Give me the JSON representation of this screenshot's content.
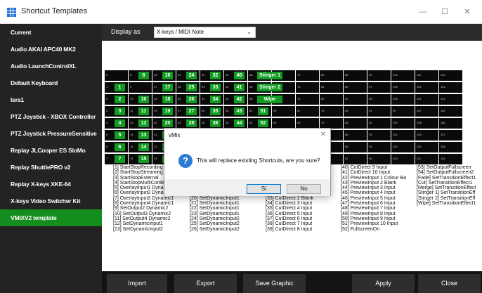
{
  "window": {
    "title": "Shortcut Templates",
    "minimize": "—",
    "maximize": "☐",
    "close": "✕"
  },
  "sidebar": {
    "items": [
      {
        "label": "Current",
        "active": false
      },
      {
        "label": "Audio AKAI APC40 MK2",
        "active": false
      },
      {
        "label": "Audio LaunchControlXL",
        "active": false
      },
      {
        "label": "Default Keyboard",
        "active": false
      },
      {
        "label": "Isra1",
        "active": false
      },
      {
        "label": "PTZ Joystick - XBOX Controller",
        "active": false
      },
      {
        "label": "PTZ Joystick PressureSensitive",
        "active": false
      },
      {
        "label": "Replay JLCooper ES SloMo",
        "active": false
      },
      {
        "label": "Replay ShuttlePRO v2",
        "active": false
      },
      {
        "label": "Replay X-keys XKE-64",
        "active": false
      },
      {
        "label": "X-keys Video Switcher Kit",
        "active": false
      },
      {
        "label": "VMIXV2 template",
        "active": true
      }
    ]
  },
  "topbar": {
    "display_label": "Display as",
    "display_value": "X-keys / MIDI Note"
  },
  "keypad": {
    "rows": [
      [
        {
          "n": "0",
          "c": ""
        },
        {
          "n": "8",
          "c": "8"
        },
        {
          "n": "16",
          "c": "16"
        },
        {
          "n": "24",
          "c": "24"
        },
        {
          "n": "32",
          "c": "32"
        },
        {
          "n": "40",
          "c": "40"
        },
        {
          "n": "48",
          "c": "Stinger 1"
        },
        {
          "n": "64",
          "c": ""
        },
        {
          "n": "72",
          "c": ""
        },
        {
          "n": "80",
          "c": ""
        },
        {
          "n": "88",
          "c": ""
        },
        {
          "n": "96",
          "c": ""
        },
        {
          "n": "104",
          "c": ""
        },
        {
          "n": "112",
          "c": ""
        },
        {
          "n": "120",
          "c": ""
        }
      ],
      [
        {
          "n": "1",
          "c": "1"
        },
        {
          "n": "9",
          "c": ""
        },
        {
          "n": "17",
          "c": "17"
        },
        {
          "n": "25",
          "c": "25"
        },
        {
          "n": "33",
          "c": "33"
        },
        {
          "n": "41",
          "c": "41"
        },
        {
          "n": "49",
          "c": "Stinger 2"
        },
        {
          "n": "65",
          "c": ""
        },
        {
          "n": "73",
          "c": ""
        },
        {
          "n": "81",
          "c": ""
        },
        {
          "n": "89",
          "c": ""
        },
        {
          "n": "97",
          "c": ""
        },
        {
          "n": "105",
          "c": ""
        },
        {
          "n": "113",
          "c": ""
        },
        {
          "n": "121",
          "c": ""
        }
      ],
      [
        {
          "n": "2",
          "c": "2"
        },
        {
          "n": "10",
          "c": "10"
        },
        {
          "n": "18",
          "c": "18"
        },
        {
          "n": "26",
          "c": "26"
        },
        {
          "n": "34",
          "c": "34"
        },
        {
          "n": "42",
          "c": "42"
        },
        {
          "n": "50",
          "c": "Wipe"
        },
        {
          "n": "66",
          "c": ""
        },
        {
          "n": "74",
          "c": ""
        },
        {
          "n": "82",
          "c": ""
        },
        {
          "n": "90",
          "c": ""
        },
        {
          "n": "98",
          "c": ""
        },
        {
          "n": "106",
          "c": ""
        },
        {
          "n": "114",
          "c": ""
        },
        {
          "n": "122",
          "c": ""
        }
      ],
      [
        {
          "n": "3",
          "c": "3"
        },
        {
          "n": "11",
          "c": "11"
        },
        {
          "n": "19",
          "c": "19"
        },
        {
          "n": "27",
          "c": "27"
        },
        {
          "n": "35",
          "c": "35"
        },
        {
          "n": "43",
          "c": "43"
        },
        {
          "n": "51",
          "c": "51"
        },
        {
          "n": "59",
          "c": ""
        },
        {
          "n": "67",
          "c": ""
        },
        {
          "n": "75",
          "c": ""
        },
        {
          "n": "83",
          "c": ""
        },
        {
          "n": "91",
          "c": ""
        },
        {
          "n": "99",
          "c": ""
        },
        {
          "n": "107",
          "c": ""
        },
        {
          "n": "115",
          "c": ""
        }
      ],
      [
        {
          "n": "4",
          "c": "4"
        },
        {
          "n": "12",
          "c": "12"
        },
        {
          "n": "20",
          "c": "20"
        },
        {
          "n": "28",
          "c": "28"
        },
        {
          "n": "36",
          "c": "36"
        },
        {
          "n": "44",
          "c": "44"
        },
        {
          "n": "52",
          "c": "52"
        },
        {
          "n": "60",
          "c": ""
        },
        {
          "n": "68",
          "c": ""
        },
        {
          "n": "76",
          "c": ""
        },
        {
          "n": "84",
          "c": ""
        },
        {
          "n": "92",
          "c": ""
        },
        {
          "n": "100",
          "c": ""
        },
        {
          "n": "108",
          "c": ""
        },
        {
          "n": "116",
          "c": ""
        }
      ],
      [
        {
          "n": "5",
          "c": "5"
        },
        {
          "n": "13",
          "c": "13"
        },
        {
          "n": "21",
          "c": "21"
        },
        {
          "n": "29",
          "c": ""
        },
        {
          "n": "37",
          "c": ""
        },
        {
          "n": "45",
          "c": ""
        },
        {
          "n": "53",
          "c": ""
        },
        {
          "n": "61",
          "c": ""
        },
        {
          "n": "69",
          "c": ""
        },
        {
          "n": "77",
          "c": ""
        },
        {
          "n": "85",
          "c": ""
        },
        {
          "n": "93",
          "c": ""
        },
        {
          "n": "101",
          "c": ""
        },
        {
          "n": "109",
          "c": ""
        },
        {
          "n": "117",
          "c": ""
        }
      ],
      [
        {
          "n": "6",
          "c": "6"
        },
        {
          "n": "14",
          "c": "14"
        },
        {
          "n": "22",
          "c": "22"
        },
        {
          "n": "30",
          "c": ""
        },
        {
          "n": "38",
          "c": ""
        },
        {
          "n": "46",
          "c": ""
        },
        {
          "n": "54",
          "c": ""
        },
        {
          "n": "62",
          "c": ""
        },
        {
          "n": "70",
          "c": ""
        },
        {
          "n": "78",
          "c": ""
        },
        {
          "n": "86",
          "c": ""
        },
        {
          "n": "94",
          "c": ""
        },
        {
          "n": "102",
          "c": ""
        },
        {
          "n": "110",
          "c": ""
        },
        {
          "n": "118",
          "c": ""
        }
      ],
      [
        {
          "n": "7",
          "c": "7"
        },
        {
          "n": "15",
          "c": "15"
        },
        {
          "n": "23",
          "c": "23"
        },
        {
          "n": "31",
          "c": ""
        },
        {
          "n": "39",
          "c": ""
        },
        {
          "n": "47",
          "c": ""
        },
        {
          "n": "55",
          "c": ""
        },
        {
          "n": "63",
          "c": ""
        },
        {
          "n": "71",
          "c": ""
        },
        {
          "n": "79",
          "c": ""
        },
        {
          "n": "87",
          "c": ""
        },
        {
          "n": "95",
          "c": ""
        },
        {
          "n": "103",
          "c": ""
        },
        {
          "n": "111",
          "c": ""
        },
        {
          "n": "119",
          "c": ""
        }
      ]
    ]
  },
  "shortcut_columns": [
    [
      "[1] StartStopRecording",
      "[2] StartStopStreaming",
      "[3] StartStopExternal",
      "[4] StartStopMultiCorder",
      "[5] OverlayInput1 Dynamic1",
      "[6] OverlayInput2 Dynamic1",
      "[7] OverlayInput3 Dynamic1",
      "[8] OverlayInput4 Dynamic1",
      "[9] SetOutput2 Dynamic2",
      "[10] SetOutput3 Dynamic2",
      "[11] SetOutput4 Dynamic2",
      "[12] SetDynamicInput1",
      "[13] SetDynamicInput2"
    ],
    [
      "",
      "",
      "",
      "",
      "",
      "",
      "[20] SetDynamicInput1",
      "[21] SetDynamicInput1",
      "[22] SetDynamicInput1",
      "[23] SetDynamicInput1",
      "[24] SetDynamicInput2",
      "[25] SetDynamicInput2",
      "[26] SetDynamicInput2"
    ],
    [
      "",
      "",
      "",
      "",
      "",
      "",
      "[33] CutDirect 2 Blank",
      "[34] CutDirect 3 Input",
      "[35] CutDirect 4 Input",
      "[36] CutDirect 5 Input",
      "[37] CutDirect 6 Input",
      "[38] CutDirect 7 Input",
      "[39] CutDirect 8 Input"
    ],
    [
      "[40] CutDirect 9 Input",
      "[41] CutDirect 10 Input",
      "[42] PreviewInput 1 Colour Ba",
      "[43] PreviewInput 2 Blank",
      "[44] PreviewInput 3 Input",
      "[45] PreviewInput 4 Input",
      "[46] PreviewInput 5 Input",
      "[47] PreviewInput 6 Input",
      "[48] PreviewInput 7 Input",
      "[49] PreviewInput 8 Input",
      "[50] PreviewInput 9 Input",
      "[51] PreviewInput 10 Input",
      "[52] FullscreenOn"
    ],
    [
      "[53] SetOutputFullscreen",
      "[54] SetOutputFullscreen2",
      "[Fade] SetTransitionEffect1",
      "[Cut] SetTransitionEffect1",
      "[Merge] SetTransitionEffect",
      "[Stinger 1] SetTransitionEff",
      "[Stinger 2] SetTransitionEff",
      "[Wipe] SetTransitionEffect1",
      "",
      "",
      "",
      "",
      ""
    ]
  ],
  "bottom_buttons": {
    "import": "Import",
    "export": "Export",
    "save_graphic": "Save Graphic",
    "apply": "Apply",
    "close": "Close"
  },
  "dialog": {
    "title": "vMix",
    "message": "This will replace existing Shortcuts, are you sure?",
    "yes": "Sí",
    "no": "No",
    "close": "✕"
  },
  "colors": {
    "accent_green": "#148c1e",
    "key_green": "#119b23",
    "sidebar_bg": "#232323"
  }
}
